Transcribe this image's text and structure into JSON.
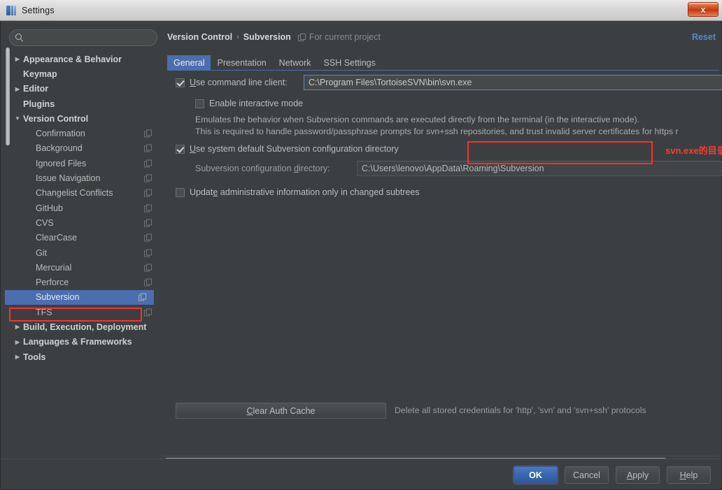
{
  "window": {
    "title": "Settings",
    "app_icon": "intellij-icon",
    "close_label": "x"
  },
  "search": {
    "value": "",
    "placeholder": "",
    "icon": "search-icon"
  },
  "sidebar": {
    "items": [
      {
        "label": "Appearance & Behavior",
        "level": 0,
        "arrow": "▶",
        "expandable": true,
        "selected": false,
        "project_icon": false
      },
      {
        "label": "Keymap",
        "level": 0,
        "arrow": "",
        "expandable": false,
        "selected": false,
        "project_icon": false
      },
      {
        "label": "Editor",
        "level": 0,
        "arrow": "▶",
        "expandable": true,
        "selected": false,
        "project_icon": false
      },
      {
        "label": "Plugins",
        "level": 0,
        "arrow": "",
        "expandable": false,
        "selected": false,
        "project_icon": false
      },
      {
        "label": "Version Control",
        "level": 0,
        "arrow": "▼",
        "expandable": true,
        "selected": false,
        "project_icon": false
      },
      {
        "label": "Confirmation",
        "level": 1,
        "arrow": "",
        "expandable": false,
        "selected": false,
        "project_icon": true
      },
      {
        "label": "Background",
        "level": 1,
        "arrow": "",
        "expandable": false,
        "selected": false,
        "project_icon": true
      },
      {
        "label": "Ignored Files",
        "level": 1,
        "arrow": "",
        "expandable": false,
        "selected": false,
        "project_icon": true
      },
      {
        "label": "Issue Navigation",
        "level": 1,
        "arrow": "",
        "expandable": false,
        "selected": false,
        "project_icon": true
      },
      {
        "label": "Changelist Conflicts",
        "level": 1,
        "arrow": "",
        "expandable": false,
        "selected": false,
        "project_icon": true
      },
      {
        "label": "GitHub",
        "level": 1,
        "arrow": "",
        "expandable": false,
        "selected": false,
        "project_icon": true
      },
      {
        "label": "CVS",
        "level": 1,
        "arrow": "",
        "expandable": false,
        "selected": false,
        "project_icon": true
      },
      {
        "label": "ClearCase",
        "level": 1,
        "arrow": "",
        "expandable": false,
        "selected": false,
        "project_icon": true
      },
      {
        "label": "Git",
        "level": 1,
        "arrow": "",
        "expandable": false,
        "selected": false,
        "project_icon": true
      },
      {
        "label": "Mercurial",
        "level": 1,
        "arrow": "",
        "expandable": false,
        "selected": false,
        "project_icon": true
      },
      {
        "label": "Perforce",
        "level": 1,
        "arrow": "",
        "expandable": false,
        "selected": false,
        "project_icon": true
      },
      {
        "label": "Subversion",
        "level": 1,
        "arrow": "",
        "expandable": false,
        "selected": true,
        "project_icon": true
      },
      {
        "label": "TFS",
        "level": 1,
        "arrow": "",
        "expandable": false,
        "selected": false,
        "project_icon": true
      },
      {
        "label": "Build, Execution, Deployment",
        "level": 0,
        "arrow": "▶",
        "expandable": true,
        "selected": false,
        "project_icon": false
      },
      {
        "label": "Languages & Frameworks",
        "level": 0,
        "arrow": "▶",
        "expandable": true,
        "selected": false,
        "project_icon": false
      },
      {
        "label": "Tools",
        "level": 0,
        "arrow": "▶",
        "expandable": true,
        "selected": false,
        "project_icon": false
      }
    ]
  },
  "breadcrumb": {
    "root": "Version Control",
    "separator": "›",
    "leaf": "Subversion",
    "scope_note": "For current project",
    "scope_icon": "project-scope-icon"
  },
  "header": {
    "reset_label": "Reset"
  },
  "tabs": [
    {
      "label": "General",
      "active": true
    },
    {
      "label": "Presentation",
      "active": false
    },
    {
      "label": "Network",
      "active": false
    },
    {
      "label": "SSH Settings",
      "active": false
    }
  ],
  "main": {
    "use_command_line_client": {
      "label": "Use command line client:",
      "mnemonic": "U",
      "checked": true,
      "path_value": "C:\\Program Files\\TortoiseSVN\\bin\\svn.exe"
    },
    "enable_interactive_mode": {
      "label": "Enable interactive mode",
      "checked": false
    },
    "description_line_1": "Emulates the behavior when Subversion commands are executed directly from the terminal (in the interactive mode).",
    "description_line_2": "This is required to handle password/passphrase prompts for svn+ssh repositories, and trust invalid server certificates for https r",
    "use_system_default_config_dir": {
      "label": "Use system default Subversion configuration directory",
      "mnemonic": "U",
      "checked": true
    },
    "config_dir": {
      "label": "Subversion configuration directory:",
      "mnemonic": "d",
      "value": "C:\\Users\\lenovo\\AppData\\Roaming\\Subversion"
    },
    "update_admin_info": {
      "label": "Update administrative information only in changed subtrees",
      "mnemonic": "e",
      "checked": false
    },
    "clear_auth_cache": {
      "label": "Clear Auth Cache",
      "mnemonic": "C",
      "note": "Delete all stored credentials for 'http', 'svn' and 'svn+ssh' protocols"
    }
  },
  "annotations": {
    "svn_path_note": "svn.exe的目录",
    "highlight_color": "#ff2d2d"
  },
  "footer": {
    "ok": "OK",
    "cancel": "Cancel",
    "apply": "Apply",
    "apply_mnemonic": "A",
    "help": "Help",
    "help_mnemonic": "H"
  },
  "colors": {
    "accent": "#4b6eaf",
    "background": "#3c3f41",
    "link": "#5a87c9",
    "annotation": "#ff3b30"
  }
}
